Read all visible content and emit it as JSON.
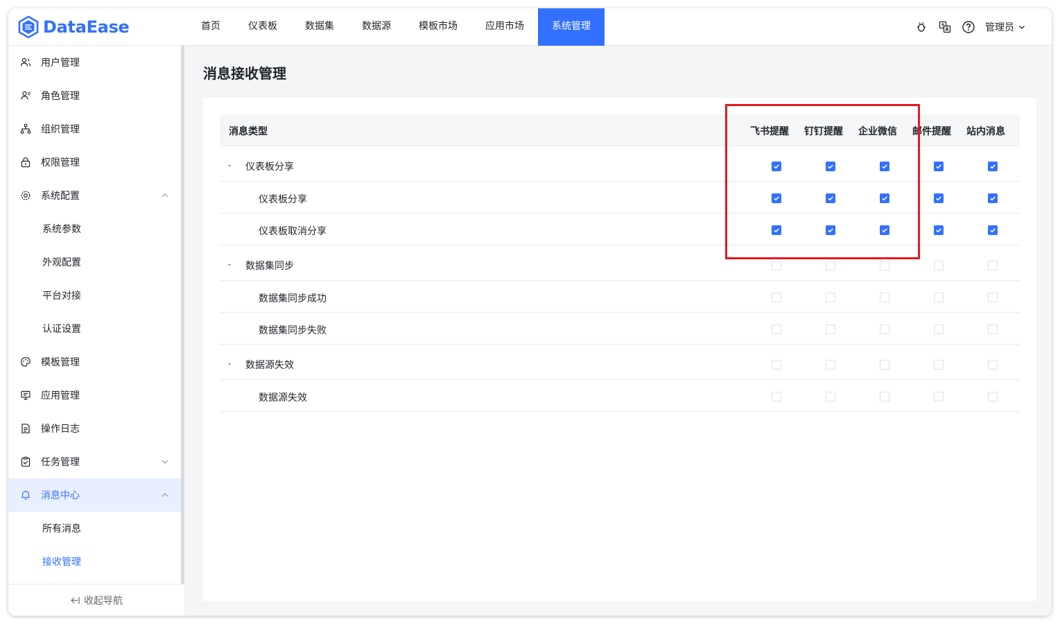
{
  "app": {
    "name": "DataEase",
    "brand_color": "#3370ff"
  },
  "nav": {
    "items": [
      {
        "label": "首页",
        "name": "nav-home"
      },
      {
        "label": "仪表板",
        "name": "nav-dashboard"
      },
      {
        "label": "数据集",
        "name": "nav-dataset"
      },
      {
        "label": "数据源",
        "name": "nav-datasource"
      },
      {
        "label": "模板市场",
        "name": "nav-template-market"
      },
      {
        "label": "应用市场",
        "name": "nav-app-market"
      },
      {
        "label": "系统管理",
        "name": "nav-system-management",
        "active": true
      }
    ]
  },
  "topright": {
    "user": "管理员",
    "icons": [
      "bug-icon",
      "translate-icon",
      "help-icon"
    ]
  },
  "sidebar": {
    "items": [
      {
        "label": "用户管理",
        "icon": "users-icon",
        "name": "sidebar-item-user-management"
      },
      {
        "label": "角色管理",
        "icon": "role-icon",
        "name": "sidebar-item-role-management"
      },
      {
        "label": "组织管理",
        "icon": "org-icon",
        "name": "sidebar-item-org-management"
      },
      {
        "label": "权限管理",
        "icon": "lock-icon",
        "name": "sidebar-item-permission-management"
      },
      {
        "label": "系统配置",
        "icon": "gear-icon",
        "name": "sidebar-item-system-config",
        "arrow": "up"
      },
      {
        "label": "系统参数",
        "name": "sidebar-item-system-params",
        "sub": true
      },
      {
        "label": "外观配置",
        "name": "sidebar-item-appearance",
        "sub": true
      },
      {
        "label": "平台对接",
        "name": "sidebar-item-platform",
        "sub": true
      },
      {
        "label": "认证设置",
        "name": "sidebar-item-auth",
        "sub": true
      },
      {
        "label": "模板管理",
        "icon": "palette-icon",
        "name": "sidebar-item-template-management"
      },
      {
        "label": "应用管理",
        "icon": "monitor-icon",
        "name": "sidebar-item-app-management"
      },
      {
        "label": "操作日志",
        "icon": "log-icon",
        "name": "sidebar-item-operation-log"
      },
      {
        "label": "任务管理",
        "icon": "clipboard-icon",
        "name": "sidebar-item-task-management",
        "arrow": "down"
      },
      {
        "label": "消息中心",
        "icon": "bell-icon",
        "name": "sidebar-item-message-center",
        "arrow": "up",
        "highlight": true
      },
      {
        "label": "所有消息",
        "name": "sidebar-item-all-messages",
        "sub": true
      },
      {
        "label": "接收管理",
        "name": "sidebar-item-receive-management",
        "sub": true,
        "active": true
      }
    ],
    "collapse_label": "收起导航"
  },
  "page": {
    "title": "消息接收管理"
  },
  "table": {
    "type_header": "消息类型",
    "columns": [
      "飞书提醒",
      "钉钉提醒",
      "企业微信",
      "邮件提醒",
      "站内消息"
    ],
    "rows": [
      {
        "label": "仪表板分享",
        "level": 0,
        "checks": [
          true,
          true,
          true,
          true,
          true
        ]
      },
      {
        "label": "仪表板分享",
        "level": 1,
        "checks": [
          true,
          true,
          true,
          true,
          true
        ]
      },
      {
        "label": "仪表板取消分享",
        "level": 1,
        "checks": [
          true,
          true,
          true,
          true,
          true
        ]
      },
      {
        "label": "数据集同步",
        "level": 0,
        "checks": [
          false,
          false,
          false,
          false,
          false
        ]
      },
      {
        "label": "数据集同步成功",
        "level": 1,
        "checks": [
          false,
          false,
          false,
          false,
          false
        ]
      },
      {
        "label": "数据集同步失败",
        "level": 1,
        "checks": [
          false,
          false,
          false,
          false,
          false
        ]
      },
      {
        "label": "数据源失效",
        "level": 0,
        "checks": [
          false,
          false,
          false,
          false,
          false
        ]
      },
      {
        "label": "数据源失效",
        "level": 1,
        "checks": [
          false,
          false,
          false,
          false,
          false
        ]
      }
    ]
  },
  "highlight_color": "#e8171f"
}
